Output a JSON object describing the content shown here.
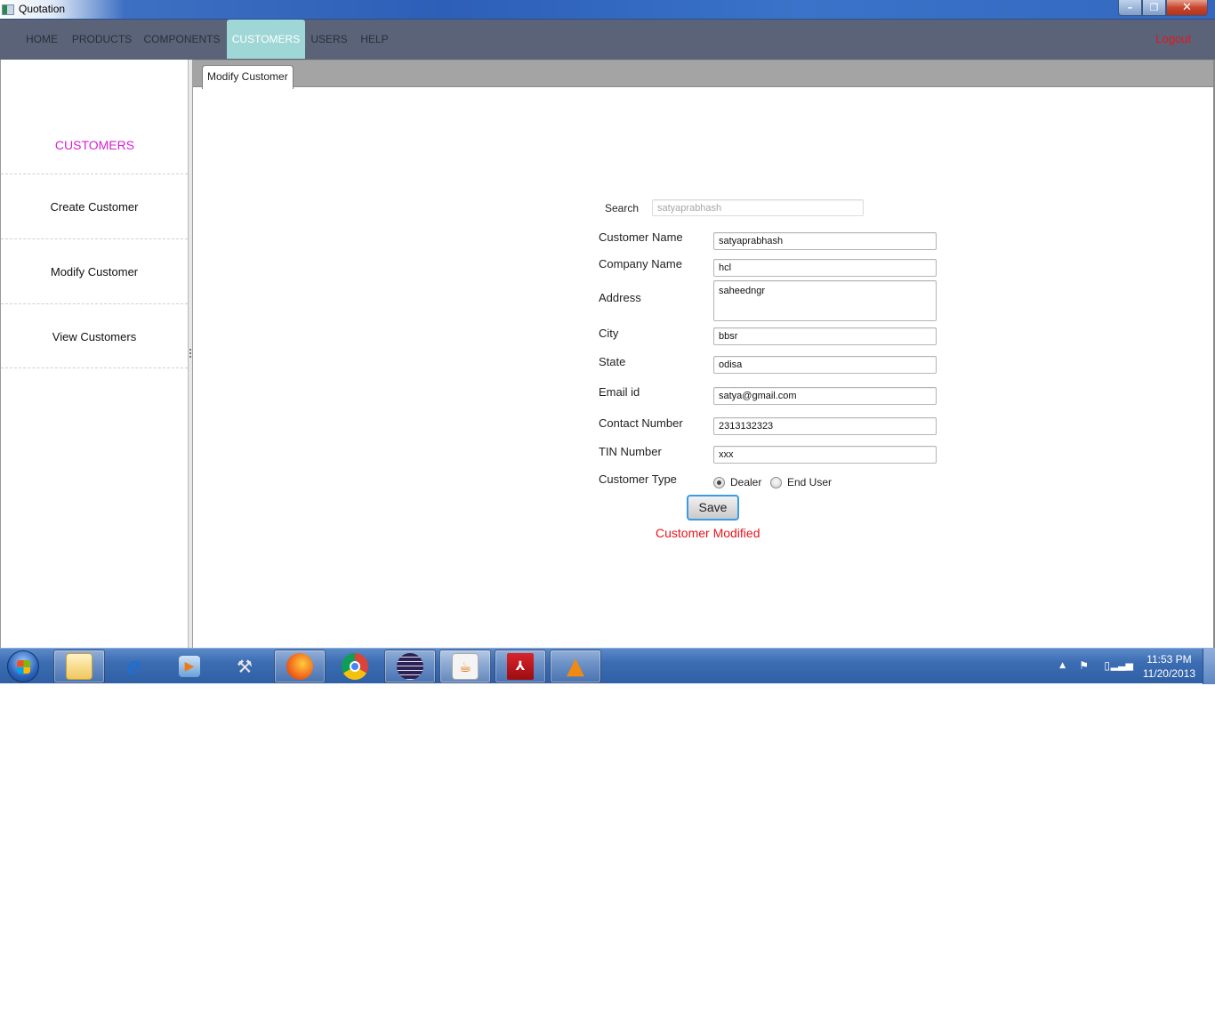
{
  "window": {
    "title": "Quotation",
    "minimize_glyph": "–",
    "restore_glyph": "❐",
    "close_glyph": "✕"
  },
  "menubar": {
    "items": [
      {
        "label": "HOME",
        "active": false
      },
      {
        "label": "PRODUCTS",
        "active": false
      },
      {
        "label": "COMPONENTS",
        "active": false
      },
      {
        "label": "CUSTOMERS",
        "active": true
      },
      {
        "label": "USERS",
        "active": false
      },
      {
        "label": "HELP",
        "active": false
      }
    ],
    "logout_label": "Logout"
  },
  "sidebar": {
    "title": "CUSTOMERS",
    "items": [
      {
        "label": "Create Customer"
      },
      {
        "label": "Modify Customer"
      },
      {
        "label": "View Customers"
      }
    ]
  },
  "tabs": [
    {
      "label": "Modify Customer",
      "active": true
    }
  ],
  "form": {
    "search": {
      "label": "Search",
      "value": "satyaprabhash"
    },
    "fields": [
      {
        "label": "Customer Name",
        "value": "satyaprabhash"
      },
      {
        "label": "Company Name",
        "value": "hcl"
      },
      {
        "label": "Address",
        "value": "saheedngr"
      },
      {
        "label": "City",
        "value": "bbsr"
      },
      {
        "label": "State",
        "value": "odisa"
      },
      {
        "label": "Email id",
        "value": "satya@gmail.com"
      },
      {
        "label": "Contact Number",
        "value": "2313132323"
      },
      {
        "label": "TIN Number",
        "value": "xxx"
      }
    ],
    "customer_type": {
      "label": "Customer Type",
      "options": [
        {
          "label": "Dealer",
          "selected": true
        },
        {
          "label": "End User",
          "selected": false
        }
      ]
    },
    "save_label": "Save",
    "status_message": "Customer Modified"
  },
  "colors": {
    "menubar_bg": "#5a6378",
    "menu_active_bg": "#9fd6d6",
    "sidebar_title": "#d61fd6",
    "error_red": "#e8141e",
    "focus_blue": "#3d9be3"
  },
  "taskbar": {
    "start_icon": "windows-start-orb",
    "apps": [
      {
        "name": "windows-explorer",
        "pinned_open": true
      },
      {
        "name": "internet-explorer",
        "pinned_open": false
      },
      {
        "name": "windows-media-player",
        "pinned_open": false
      },
      {
        "name": "database-tools",
        "pinned_open": false
      },
      {
        "name": "firefox",
        "pinned_open": true
      },
      {
        "name": "chrome",
        "pinned_open": false
      },
      {
        "name": "eclipse",
        "pinned_open": true
      },
      {
        "name": "java",
        "pinned_open": true
      },
      {
        "name": "adobe-reader",
        "pinned_open": true
      },
      {
        "name": "vlc",
        "pinned_open": true
      }
    ],
    "clock": {
      "time": "11:53 PM",
      "date": "11/20/2013"
    }
  }
}
